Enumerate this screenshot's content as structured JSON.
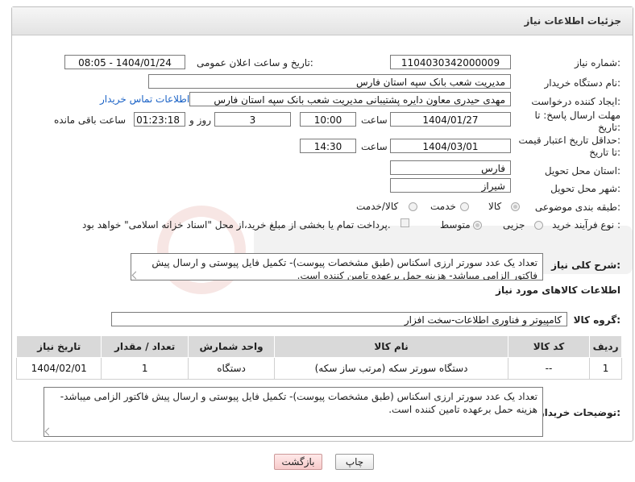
{
  "panel": {
    "title": "جزئیات اطلاعات نیاز"
  },
  "fields": {
    "need_number_label": "شماره نیاز:",
    "need_number": "1104030342000009",
    "announce_label": "تاریخ و ساعت اعلان عمومی:",
    "announce_value": "1404/01/24 - 08:05",
    "buyer_org_label": "نام دستگاه خریدار:",
    "buyer_org": "مدیریت شعب بانک سپه استان فارس",
    "creator_label": "ایجاد کننده درخواست:",
    "creator": "مهدی حیدری معاون دایره پشتیبانی مدیریت شعب بانک سپه استان فارس",
    "contact_link": "اطلاعات تماس خریدار",
    "deadline_label_1": "مهلت ارسال پاسخ: تا",
    "deadline_label_2": "تاریخ:",
    "deadline_date": "1404/01/27",
    "time_label": "ساعت",
    "deadline_time": "10:00",
    "days_value": "3",
    "days_label": "روز و",
    "remaining_value": "01:23:18",
    "remaining_label": "ساعت باقی مانده",
    "price_label_1": "حداقل تاریخ اعتبار قیمت:",
    "price_label_2": "تا تاریخ:",
    "price_date": "1404/03/01",
    "price_time_label": "ساعت",
    "price_time": "14:30",
    "province_label": "استان محل تحویل:",
    "province": "فارس",
    "city_label": "شهر محل تحویل:",
    "city": "شیراز",
    "category_label": "طبقه بندی موضوعی:",
    "category_options": [
      "کالا",
      "خدمت",
      "کالا/خدمت"
    ],
    "process_label": "نوع فرآیند خرید :",
    "process_options": [
      "جزیی",
      "متوسط"
    ],
    "payment_note": "پرداخت تمام یا بخشی از مبلغ خرید،از محل \"اسناد خزانه اسلامی\" خواهد بود."
  },
  "summary": {
    "label": "شرح کلی نیاز:",
    "text": "تعداد یک عدد سورتر ارزی اسکناس (طبق مشخصات پیوست)- تکمیل فایل پیوستی و ارسال پیش فاکتور الزامی میباشد- هزینه حمل برعهده تامین کننده است."
  },
  "goods": {
    "section_title": "اطلاعات کالاهای مورد نیاز",
    "group_label": "گروه کالا:",
    "group_value": "کامپیوتر و فناوری اطلاعات-سخت افزار"
  },
  "table": {
    "headers": [
      "ردیف",
      "کد کالا",
      "نام کالا",
      "واحد شمارش",
      "تعداد / مقدار",
      "تاریخ نیاز"
    ],
    "rows": [
      [
        "1",
        "--",
        "دستگاه سورتر سکه (مرتب ساز سکه)",
        "دستگاه",
        "1",
        "1404/02/01"
      ]
    ]
  },
  "buyer_notes": {
    "label": "توضیحات خریدار:",
    "text": "تعداد یک عدد سورتر ارزی اسکناس (طبق مشخصات پیوست)- تکمیل فایل پیوستی و ارسال پیش فاکتور الزامی میباشد- هزینه حمل برعهده تامین کننده است."
  },
  "buttons": {
    "print": "چاپ",
    "back": "بازگشت"
  },
  "colors": {
    "link": "#1a62c6",
    "header_bg": "#e3e3e3",
    "table_header": "#d9d9d9",
    "back_button": "#f7caca"
  }
}
